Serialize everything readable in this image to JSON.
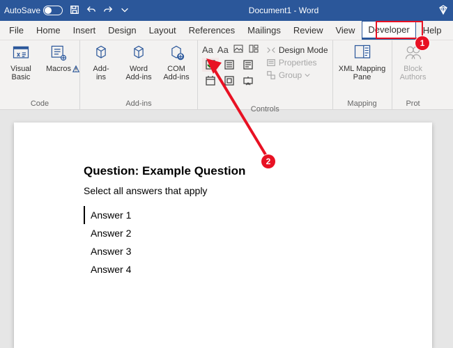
{
  "titlebar": {
    "autosave": "AutoSave",
    "docname": "Document1 - Word"
  },
  "tabs": [
    "File",
    "Home",
    "Insert",
    "Design",
    "Layout",
    "References",
    "Mailings",
    "Review",
    "View",
    "Developer",
    "Help"
  ],
  "activeTab": "Developer",
  "ribbon": {
    "code": {
      "label": "Code",
      "visualbasic": "Visual\nBasic",
      "macros": "Macros"
    },
    "addins": {
      "label": "Add-ins",
      "addins": "Add-\nins",
      "word": "Word\nAdd-ins",
      "com": "COM\nAdd-ins"
    },
    "controls": {
      "label": "Controls",
      "design": "Design Mode",
      "properties": "Properties",
      "group": "Group"
    },
    "mapping": {
      "label": "Mapping",
      "xmlpane": "XML Mapping\nPane"
    },
    "protect": {
      "label": "Prot",
      "block": "Block\nAuthors"
    }
  },
  "doc": {
    "heading": "Question: Example Question",
    "prompt": "Select all answers that apply",
    "answers": [
      "Answer 1",
      "Answer 2",
      "Answer 3",
      "Answer 4"
    ]
  },
  "anno": {
    "one": "1",
    "two": "2"
  }
}
